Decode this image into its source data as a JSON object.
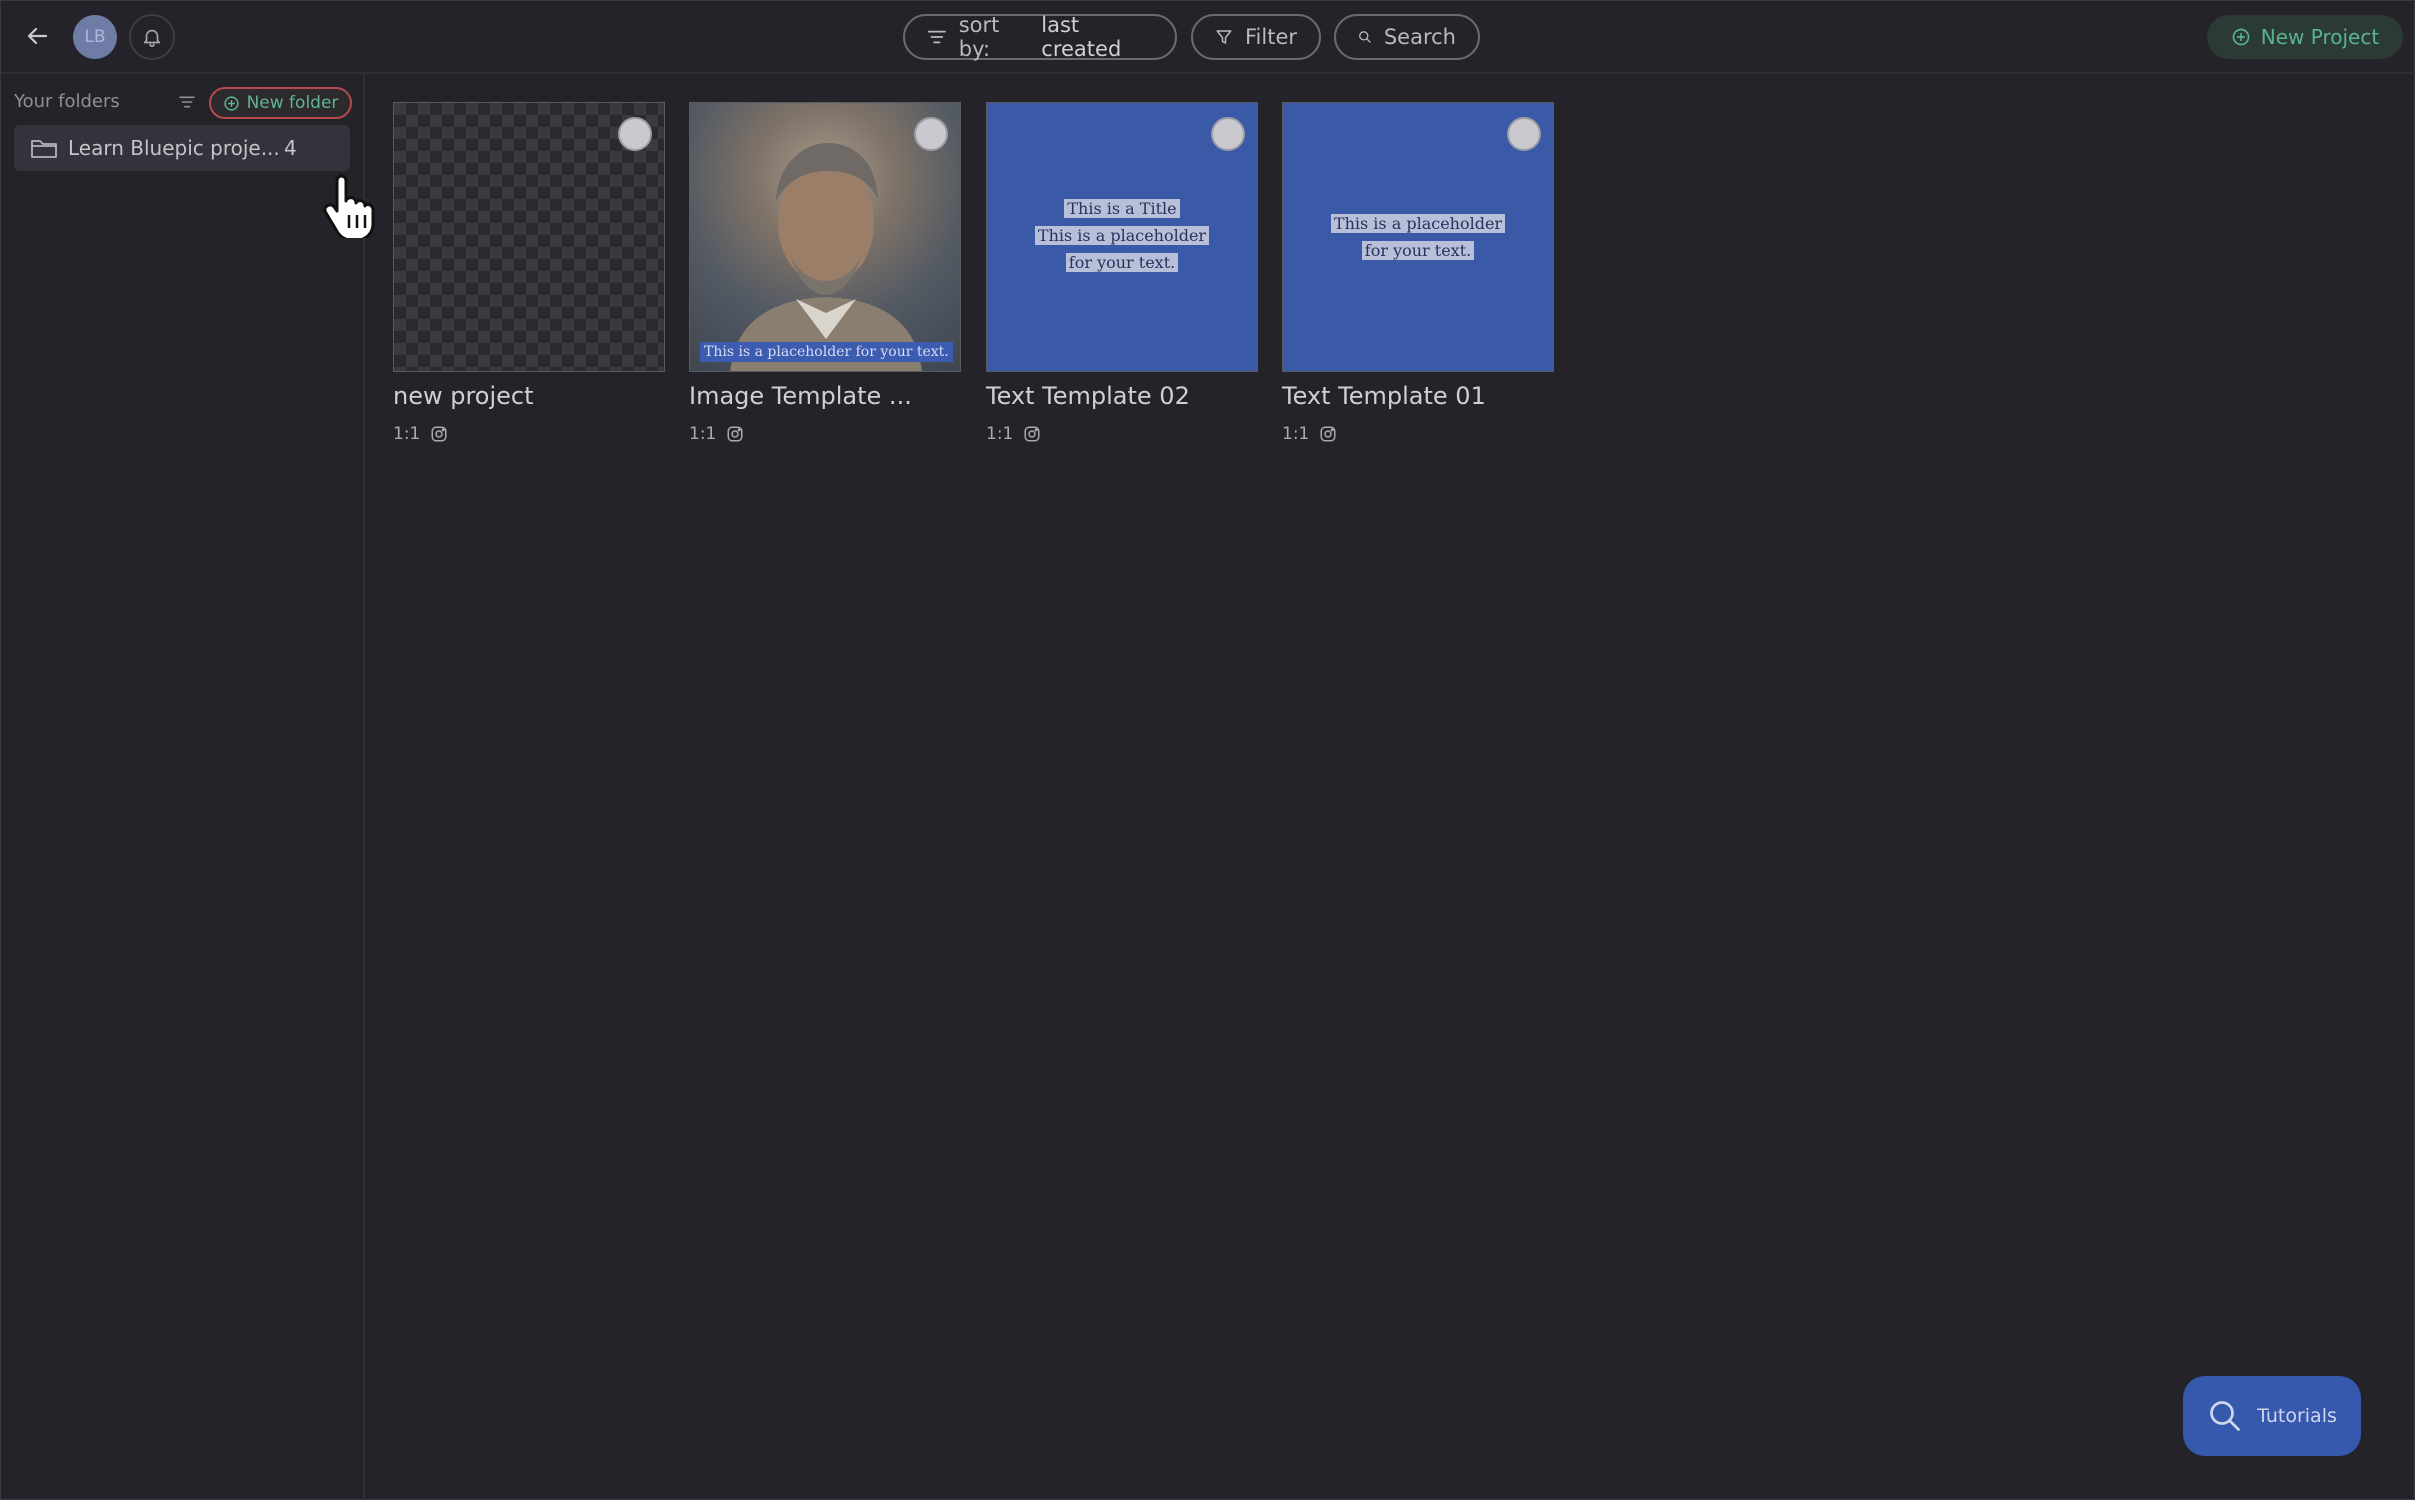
{
  "topbar": {
    "avatar_initials": "LB",
    "sort_prefix": "sort by:",
    "sort_value": "last created",
    "filter_label": "Filter",
    "search_label": "Search",
    "new_project_label": "New Project"
  },
  "sidebar": {
    "title": "Your folders",
    "new_folder_label": "New folder",
    "folders": [
      {
        "name": "Learn Bluepic proje...",
        "count": "4"
      }
    ]
  },
  "projects": [
    {
      "title": "new project",
      "ratio": "1:1",
      "platform_icon": "instagram-icon"
    },
    {
      "title": "Image Template ...",
      "ratio": "1:1",
      "platform_icon": "instagram-icon",
      "caption": "This is a placeholder for your text."
    },
    {
      "title": "Text Template 02",
      "ratio": "1:1",
      "platform_icon": "instagram-icon",
      "lines": [
        "This is a Title",
        "This is a placeholder",
        "for your text."
      ]
    },
    {
      "title": "Text Template 01",
      "ratio": "1:1",
      "platform_icon": "instagram-icon",
      "lines": [
        "This is a placeholder",
        "for your text."
      ]
    }
  ],
  "tutorials_label": "Tutorials",
  "colors": {
    "background": "#232329",
    "accent_green": "#59b38f",
    "accent_blue": "#3658ad",
    "new_folder_border": "#b34a4e"
  }
}
